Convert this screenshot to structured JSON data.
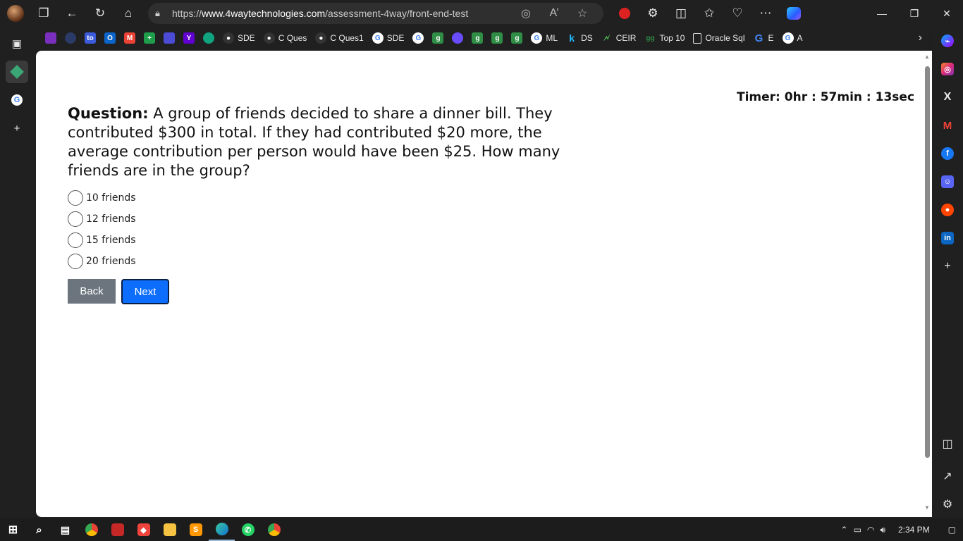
{
  "browser": {
    "url_prefix": "https://",
    "url_host": "www.4waytechnologies.com",
    "url_path": "/assessment-4way/front-end-test"
  },
  "favorites": [
    {
      "label": "",
      "icon": "purple-app-icon",
      "color": "#7b2fbe"
    },
    {
      "label": "",
      "icon": "dark-circle-icon",
      "color": "#2b3a67"
    },
    {
      "label": "",
      "icon": "to-icon",
      "color": "#3b5bdb"
    },
    {
      "label": "",
      "icon": "outlook-icon",
      "color": "#0a64c9"
    },
    {
      "label": "",
      "icon": "gmail-icon",
      "color": "#ea4335"
    },
    {
      "label": "",
      "icon": "sheets-icon",
      "color": "#1e9e4a"
    },
    {
      "label": "",
      "icon": "stack-icon",
      "color": "#4b4bd6"
    },
    {
      "label": "",
      "icon": "yahoo-icon",
      "color": "#6001d2"
    },
    {
      "label": "",
      "icon": "chatgpt-icon",
      "color": "#10a37f"
    },
    {
      "label": "SDE",
      "icon": "github-icon",
      "color": "#333333"
    },
    {
      "label": "C Ques",
      "icon": "github-icon",
      "color": "#333333"
    },
    {
      "label": "C Ques1",
      "icon": "github-icon",
      "color": "#333333"
    },
    {
      "label": "SDE",
      "icon": "google-icon",
      "color": "#ffffff"
    },
    {
      "label": "",
      "icon": "google-icon",
      "color": "#ffffff"
    },
    {
      "label": "",
      "icon": "gfg-icon",
      "color": "#2f8d46"
    },
    {
      "label": "",
      "icon": "leetcode-icon",
      "color": "#6a4cff"
    },
    {
      "label": "",
      "icon": "gfg-icon",
      "color": "#2f8d46"
    },
    {
      "label": "",
      "icon": "gfg-icon",
      "color": "#2f8d46"
    },
    {
      "label": "",
      "icon": "gfg-icon",
      "color": "#2f8d46"
    },
    {
      "label": "ML",
      "icon": "google-icon",
      "color": "#ffffff"
    },
    {
      "label": "DS",
      "icon": "kaggle-icon",
      "color": "#20beff"
    },
    {
      "label": "CEIR",
      "icon": "ceir-icon",
      "color": "#4caf50"
    },
    {
      "label": "Top 10",
      "icon": "gfg-icon",
      "color": "#2f8d46"
    },
    {
      "label": "Oracle Sql",
      "icon": "page-icon",
      "color": "#202020"
    },
    {
      "label": "E",
      "icon": "google-icon",
      "color": "#4285f4"
    },
    {
      "label": "A",
      "icon": "google-icon",
      "color": "#ffffff"
    }
  ],
  "page": {
    "timer": "Timer: 0hr : 57min : 13sec",
    "question_label": "Question:",
    "question_text": " A group of friends decided to share a dinner bill. They contributed $300 in total. If they had contributed $20 more, the average contribution per person would have been $25. How many friends are in the group?",
    "options": [
      "10 friends",
      "12 friends",
      "15 friends",
      "20 friends"
    ],
    "back_label": "Back",
    "next_label": "Next"
  },
  "taskbar": {
    "time": "2:34 PM"
  }
}
